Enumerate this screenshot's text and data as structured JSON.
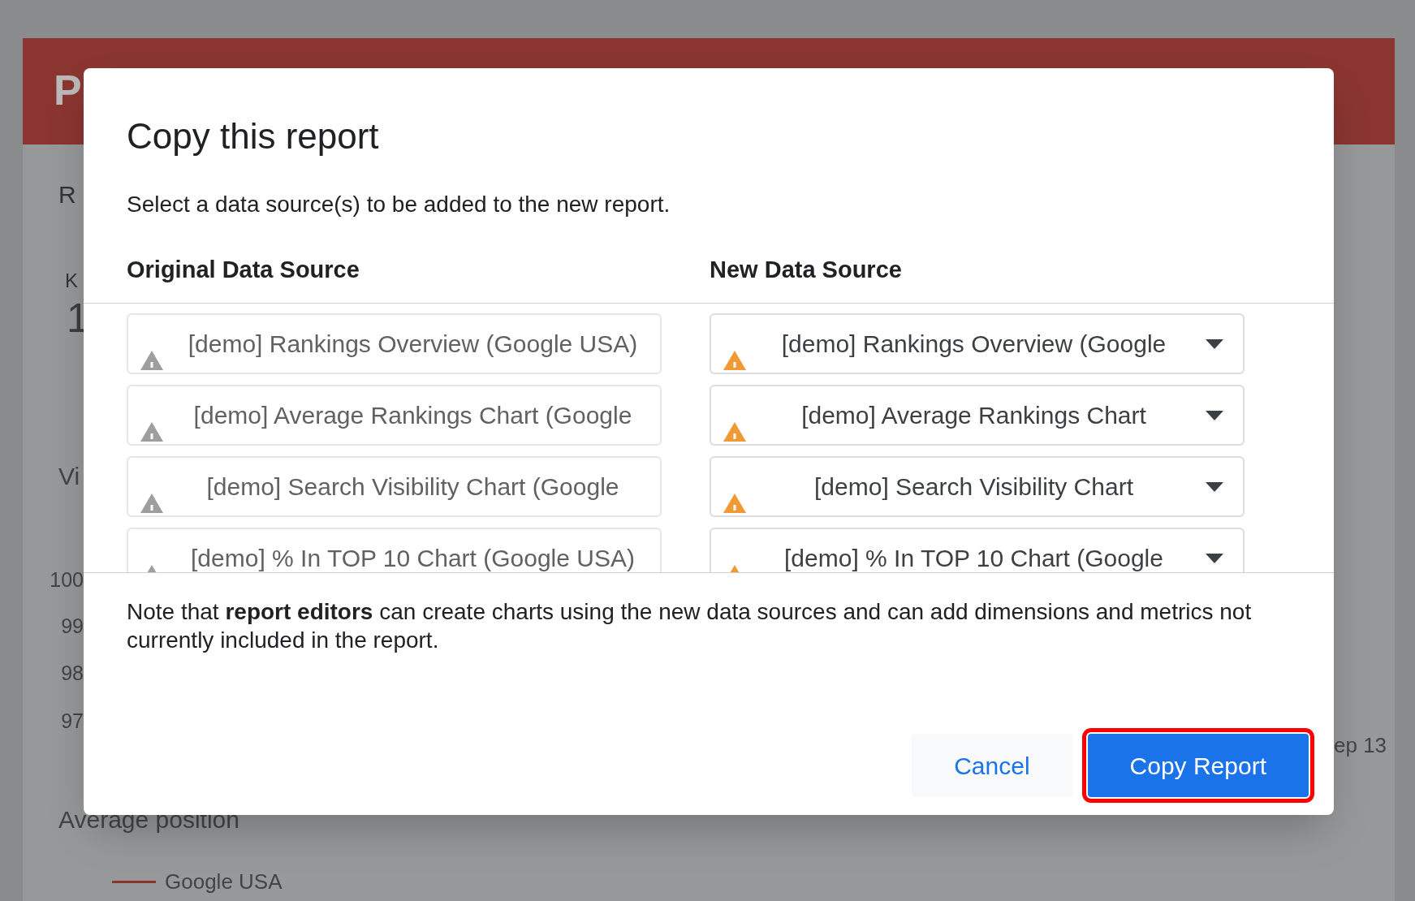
{
  "background": {
    "header_letter": "P",
    "left_texts": [
      "R",
      "K"
    ],
    "big_value": "1",
    "section": "Vi",
    "axis_labels": [
      "100",
      "99",
      "98",
      "97"
    ],
    "chart_title": "Average position",
    "legend": "Google USA",
    "x_label": "ep 13"
  },
  "dialog": {
    "title": "Copy this report",
    "subtitle": "Select a data source(s) to be added to the new report.",
    "columns": [
      "Original Data Source",
      "New Data Source"
    ],
    "rows": [
      {
        "original": "[demo] Rankings Overview (Google USA)",
        "replacement": "[demo] Rankings Overview (Google",
        "warning": true
      },
      {
        "original": "[demo] Average Rankings Chart (Google",
        "replacement": "[demo] Average Rankings Chart",
        "warning": true
      },
      {
        "original": "[demo] Search Visibility Chart (Google",
        "replacement": "[demo] Search Visibility Chart",
        "warning": true
      },
      {
        "original": "[demo] % In TOP 10 Chart (Google USA)",
        "replacement": "[demo] % In TOP 10 Chart (Google",
        "warning": true
      }
    ],
    "note": "Note that **report editors** can create charts using the new data sources and can add dimensions and metrics not currently included in the report.",
    "buttons": [
      {
        "label": "Cancel",
        "kind": "secondary",
        "highlighted": false
      },
      {
        "label": "Copy Report",
        "kind": "primary",
        "highlighted": true
      }
    ]
  }
}
